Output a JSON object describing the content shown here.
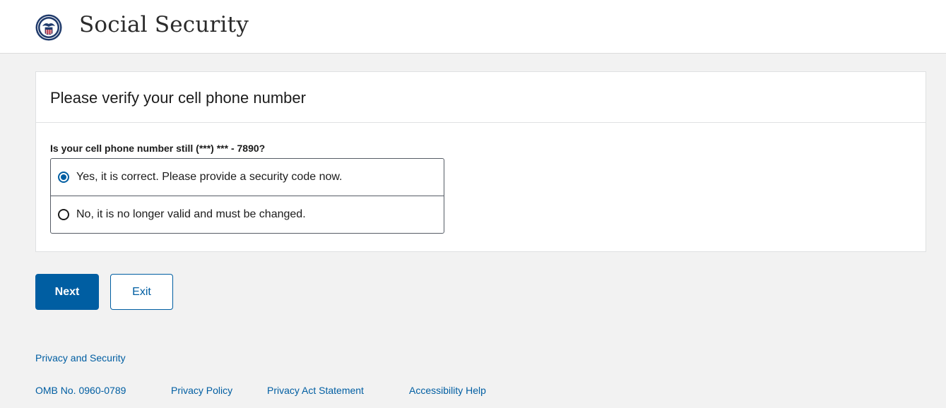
{
  "header": {
    "brand": "Social Security",
    "logo_icon": "ssa-seal-icon"
  },
  "card": {
    "title": "Please verify your cell phone number",
    "question": "Is your cell phone number still (***) *** - 7890?",
    "options": [
      {
        "label": "Yes, it is correct. Please provide a security code now.",
        "selected": true
      },
      {
        "label": "No, it is no longer valid and must be changed.",
        "selected": false
      }
    ]
  },
  "actions": {
    "next_label": "Next",
    "exit_label": "Exit"
  },
  "footer": {
    "privacy_security": "Privacy and Security",
    "links": [
      "OMB No. 0960-0789",
      "Privacy Policy",
      "Privacy Act Statement",
      "Accessibility Help"
    ]
  },
  "colors": {
    "primary": "#005ea2",
    "background": "#f2f2f2"
  }
}
